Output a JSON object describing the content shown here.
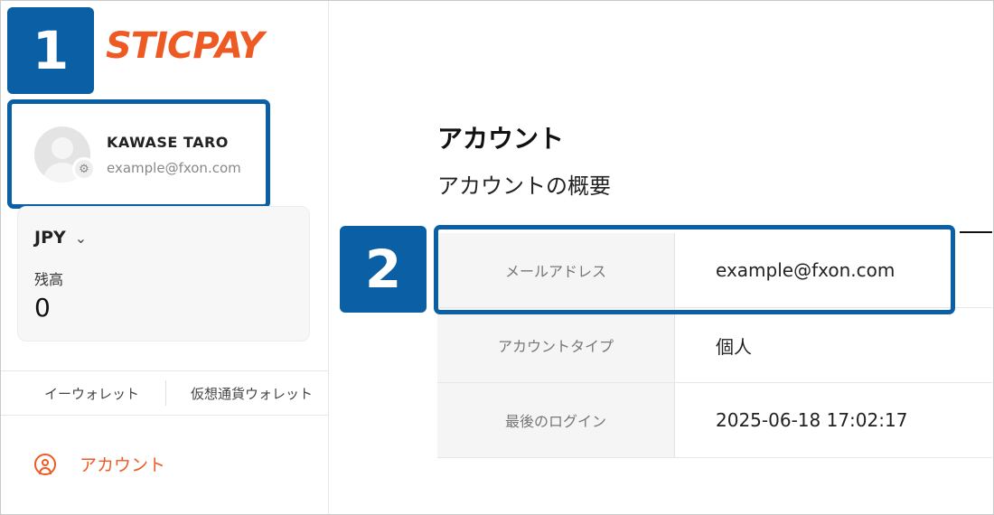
{
  "brand": {
    "logo_text": "STICPAY",
    "accent": "#ee5a24"
  },
  "annotations": {
    "step1": "1",
    "step2": "2",
    "badge_color": "#0b5fa5"
  },
  "user": {
    "name": "KAWASE TARO",
    "email": "example@fxon.com",
    "avatar_icon": "user-avatar-icon",
    "settings_icon": "gear-icon"
  },
  "balance": {
    "currency": "JPY",
    "label": "残高",
    "value": "0"
  },
  "wallet_tabs": [
    "イーウォレット",
    "仮想通貨ウォレット"
  ],
  "nav": {
    "account_label": "アカウント",
    "icon": "user-circle-icon"
  },
  "main": {
    "title": "アカウント",
    "subtitle": "アカウントの概要",
    "rows": [
      {
        "label": "メールアドレス",
        "value": "example@fxon.com"
      },
      {
        "label": "アカウントタイプ",
        "value": "個人"
      },
      {
        "label": "最後のログイン",
        "value": "2025-06-18 17:02:17"
      }
    ]
  }
}
